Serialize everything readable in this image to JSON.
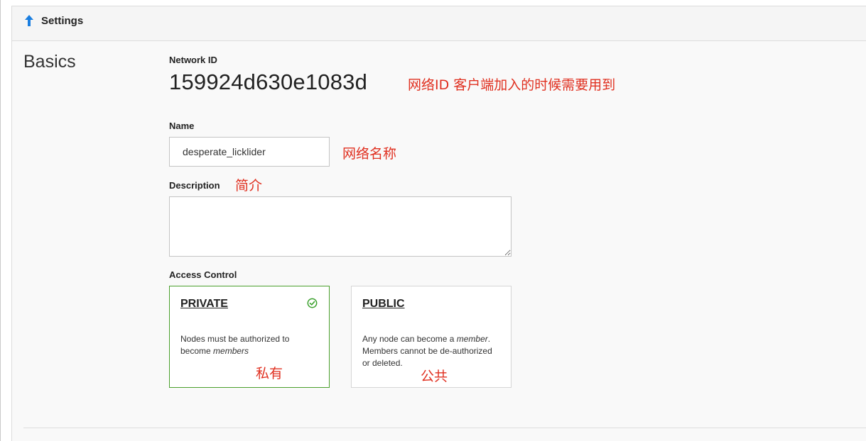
{
  "header": {
    "title": "Settings",
    "icon": "arrow-up-icon",
    "icon_color": "#1a7ee0"
  },
  "section": {
    "title": "Basics"
  },
  "network_id": {
    "label": "Network ID",
    "value": "159924d630e1083d",
    "annotation": "网络ID 客户端加入的时候需要用到"
  },
  "name": {
    "label": "Name",
    "value": "desperate_licklider",
    "annotation": "网络名称"
  },
  "description": {
    "label": "Description",
    "value": "",
    "annotation": "简介"
  },
  "access_control": {
    "label": "Access Control",
    "selected": "private",
    "options": [
      {
        "id": "private",
        "title": "PRIVATE",
        "desc_before": "Nodes must be authorized to become ",
        "desc_em": "members",
        "desc_after": "",
        "annotation": "私有",
        "selected_icon": "check-circle-icon",
        "border_color": "#4aa02c"
      },
      {
        "id": "public",
        "title": "PUBLIC",
        "desc_before": "Any node can become a ",
        "desc_em": "member",
        "desc_after": ". Members cannot be de-authorized or deleted.",
        "annotation": "公共",
        "border_color": "#d6d6d6"
      }
    ]
  },
  "colors": {
    "annotation": "#e03020",
    "selected_border": "#4aa02c",
    "panel_bg": "#f9f9f9"
  }
}
